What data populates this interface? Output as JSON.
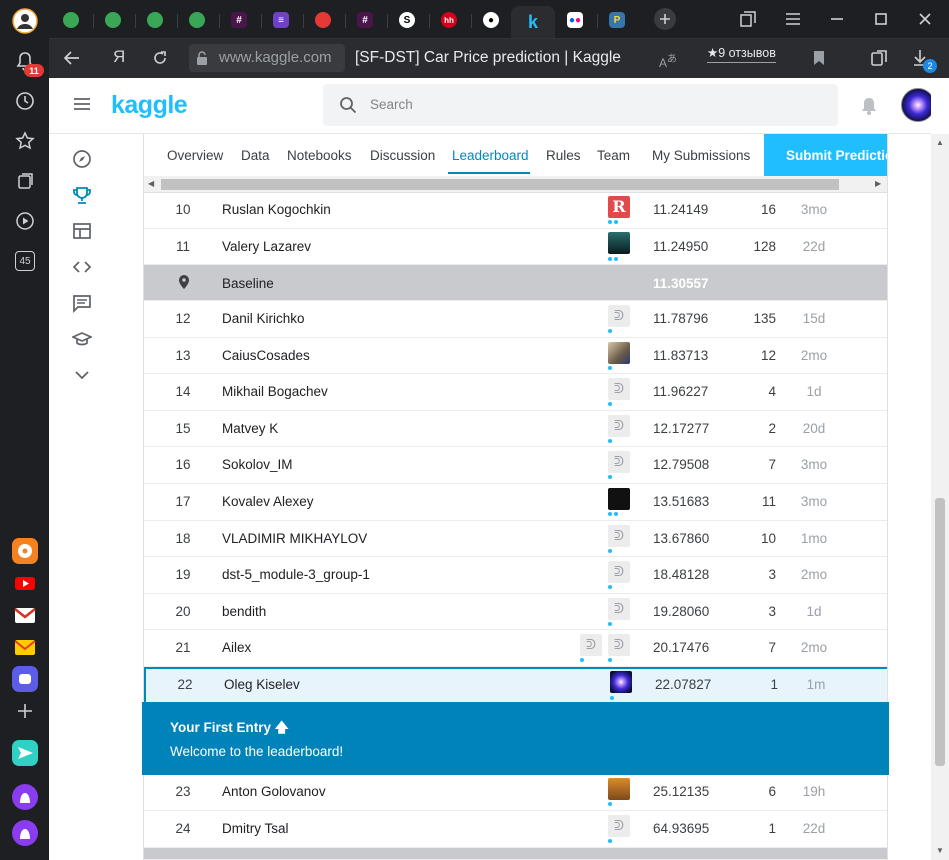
{
  "browser": {
    "url_host": "www.kaggle.com",
    "page_title": "[SF-DST] Car Price prediction | Kaggle",
    "reviews": "★9 отзывов",
    "yandex_glyph": "Я",
    "notif_count": "11",
    "sidebar_badge": "45",
    "download_count": "2",
    "tab_k_glyph": "k"
  },
  "kaggle": {
    "logo": "kaggle",
    "search_placeholder": "Search"
  },
  "tabs": [
    {
      "label": "Overview"
    },
    {
      "label": "Data"
    },
    {
      "label": "Notebooks"
    },
    {
      "label": "Discussion"
    },
    {
      "label": "Leaderboard"
    },
    {
      "label": "Rules"
    },
    {
      "label": "Team"
    },
    {
      "label": "My Submissions"
    }
  ],
  "submit_label": "Submit Prediction",
  "rows": [
    {
      "rank": "10",
      "name": "Ruslan Kogochkin",
      "score": "11.24149",
      "entries": "16",
      "last": "3mo"
    },
    {
      "rank": "11",
      "name": "Valery Lazarev",
      "score": "11.24950",
      "entries": "128",
      "last": "22d"
    },
    {
      "rank": "",
      "name": "Baseline",
      "score": "11.30557",
      "entries": "",
      "last": ""
    },
    {
      "rank": "12",
      "name": "Danil Kirichko",
      "score": "11.78796",
      "entries": "135",
      "last": "15d"
    },
    {
      "rank": "13",
      "name": "CaiusCosades",
      "score": "11.83713",
      "entries": "12",
      "last": "2mo"
    },
    {
      "rank": "14",
      "name": "Mikhail Bogachev",
      "score": "11.96227",
      "entries": "4",
      "last": "1d"
    },
    {
      "rank": "15",
      "name": "Matvey K",
      "score": "12.17277",
      "entries": "2",
      "last": "20d"
    },
    {
      "rank": "16",
      "name": "Sokolov_IM",
      "score": "12.79508",
      "entries": "7",
      "last": "3mo"
    },
    {
      "rank": "17",
      "name": "Kovalev Alexey",
      "score": "13.51683",
      "entries": "11",
      "last": "3mo"
    },
    {
      "rank": "18",
      "name": "VLADIMIR MIKHAYLOV",
      "score": "13.67860",
      "entries": "10",
      "last": "1mo"
    },
    {
      "rank": "19",
      "name": "dst-5_module-3_group-1",
      "score": "18.48128",
      "entries": "3",
      "last": "2mo"
    },
    {
      "rank": "20",
      "name": "bendith",
      "score": "19.28060",
      "entries": "3",
      "last": "1d"
    },
    {
      "rank": "21",
      "name": "Ailex",
      "score": "20.17476",
      "entries": "7",
      "last": "2mo"
    },
    {
      "rank": "22",
      "name": "Oleg Kiselev",
      "score": "22.07827",
      "entries": "1",
      "last": "1m"
    },
    {
      "rank": "23",
      "name": "Anton Golovanov",
      "score": "25.12135",
      "entries": "6",
      "last": "19h"
    },
    {
      "rank": "24",
      "name": "Dmitry Tsal",
      "score": "64.93695",
      "entries": "1",
      "last": "22d"
    }
  ],
  "banner": {
    "title": "Your First Entry 🡅",
    "subtitle": "Welcome to the leaderboard!"
  },
  "colors": {
    "kaggle_blue": "#20beff",
    "active_tab": "#008abc",
    "banner": "#0083b8",
    "baseline_row": "#c8cacd"
  }
}
